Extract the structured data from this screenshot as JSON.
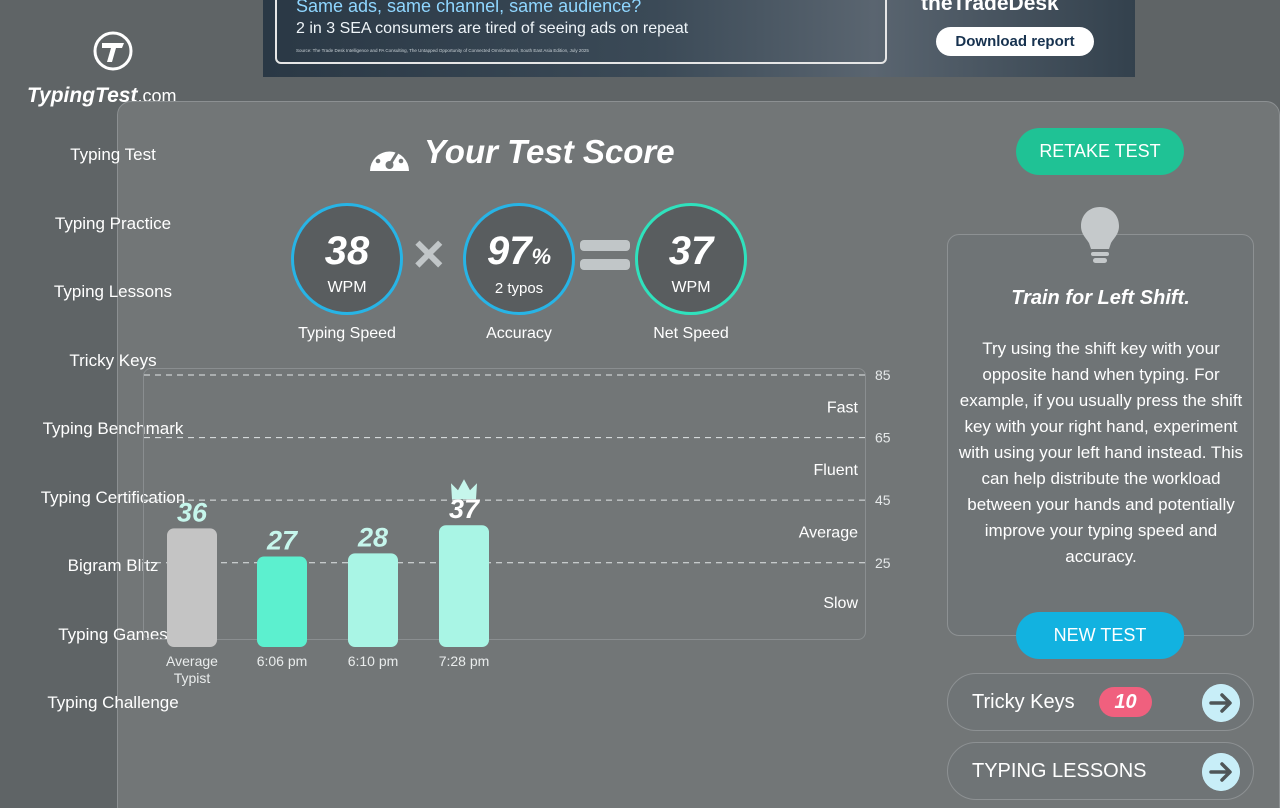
{
  "ad": {
    "headline": "Same ads, same channel, same audience?",
    "subline": "2 in 3 SEA consumers are tired of seeing ads on repeat",
    "source": "Source: The Trade Desk Intelligence and PA Consulting, The Untapped Opportunity of Connected Omnichannel, South East Asia Edition, July 2025",
    "brand": "theTradeDesk",
    "button": "Download report"
  },
  "logo": {
    "name": "TypingTest",
    "domain": ".com",
    "icon": "t-logo-icon"
  },
  "nav": {
    "items": [
      {
        "label": "Typing Test"
      },
      {
        "label": "Typing Practice"
      },
      {
        "label": "Typing Lessons"
      },
      {
        "label": "Tricky Keys"
      },
      {
        "label": "Typing Benchmark"
      },
      {
        "label": "Typing Certification"
      },
      {
        "label": "Bigram Blitz"
      },
      {
        "label": "Typing Games"
      },
      {
        "label": "Typing Challenge"
      }
    ]
  },
  "score": {
    "title": "Your Test Score",
    "speed": {
      "value": "38",
      "unit": "WPM",
      "label": "Typing Speed"
    },
    "accuracy": {
      "value": "97",
      "suffix": "%",
      "unit": "2 typos",
      "label": "Accuracy"
    },
    "net": {
      "value": "37",
      "unit": "WPM",
      "label": "Net Speed"
    }
  },
  "chart_data": {
    "type": "bar",
    "categories": [
      "Average Typist",
      "6:06 pm",
      "6:10 pm",
      "7:28 pm"
    ],
    "values": [
      36,
      27,
      28,
      37
    ],
    "value_labels": [
      "36",
      "27",
      "28",
      "37"
    ],
    "best_index": 3,
    "ylim": [
      0,
      85
    ],
    "gridlines": [
      25,
      45,
      65,
      85
    ],
    "zones": [
      {
        "label": "Fast",
        "from": 65,
        "to": 85
      },
      {
        "label": "Fluent",
        "from": 45,
        "to": 65
      },
      {
        "label": "Average",
        "from": 25,
        "to": 45
      },
      {
        "label": "Slow",
        "from": 0,
        "to": 25
      }
    ],
    "colors": {
      "average": "#c4c4c4",
      "bar": "#5cf0cf",
      "bar_light": "#a9f5e5",
      "label": "#c6f6ec",
      "best_label": "#ffffff"
    }
  },
  "actions": {
    "retake": "RETAKE TEST",
    "new_test": "NEW TEST"
  },
  "tip": {
    "title": "Train for Left Shift.",
    "body": "Try using the shift key with your opposite hand when typing. For example, if you usually press the shift key with your right hand, experiment with using your left hand instead. This can help distribute the workload between your hands and potentially improve your typing speed and accuracy."
  },
  "links": {
    "tricky": {
      "label": "Tricky Keys",
      "badge": "10"
    },
    "lessons": {
      "label": "TYPING LESSONS"
    }
  },
  "colors": {
    "accent_teal": "#1fc295",
    "accent_blue": "#12b2e0",
    "badge_pink": "#f0607e"
  }
}
